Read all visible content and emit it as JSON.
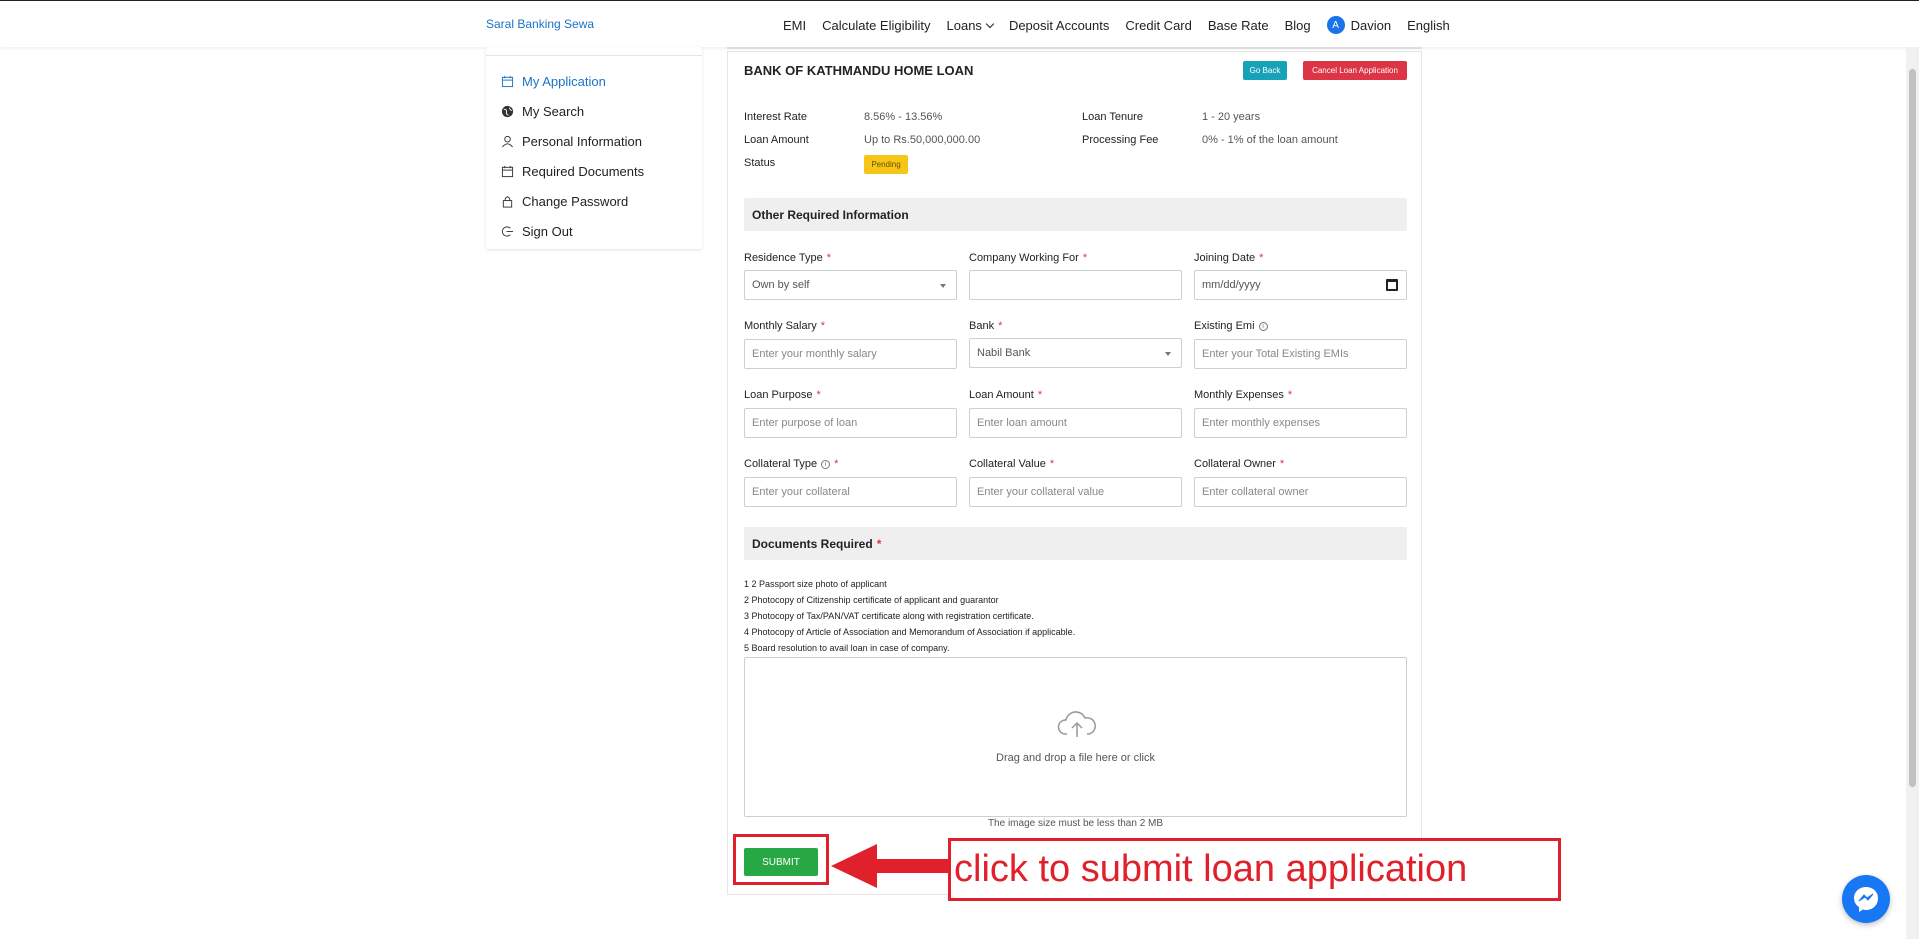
{
  "header": {
    "brand": "Saral Banking Sewa",
    "nav": [
      "EMI",
      "Calculate Eligibility",
      "Loans",
      "Deposit Accounts",
      "Credit Card",
      "Base Rate",
      "Blog"
    ],
    "user_initial": "A",
    "user_name": "Davion",
    "language": "English"
  },
  "sidebar": {
    "items": [
      {
        "label": "My Application",
        "icon": "calendar-icon",
        "active": true
      },
      {
        "label": "My Search",
        "icon": "globe-icon"
      },
      {
        "label": "Personal Information",
        "icon": "user-icon"
      },
      {
        "label": "Required Documents",
        "icon": "calendar-icon"
      },
      {
        "label": "Change Password",
        "icon": "lock-icon"
      },
      {
        "label": "Sign Out",
        "icon": "sign-out-icon"
      }
    ]
  },
  "loan": {
    "title": "BANK OF KATHMANDU HOME LOAN",
    "go_back": "Go Back",
    "cancel": "Cancel Loan Application",
    "interest_rate_label": "Interest Rate",
    "interest_rate": "8.56% - 13.56%",
    "loan_amount_label": "Loan Amount",
    "loan_amount": "Up to Rs.50,000,000.00",
    "status_label": "Status",
    "status": "Pending",
    "tenure_label": "Loan Tenure",
    "tenure": "1 - 20 years",
    "fee_label": "Processing Fee",
    "fee": "0% - 1% of the loan amount"
  },
  "form": {
    "section_title": "Other Required Information",
    "residence_type": {
      "label": "Residence Type",
      "value": "Own by self"
    },
    "company": {
      "label": "Company Working For",
      "value": ""
    },
    "joining_date": {
      "label": "Joining Date",
      "placeholder": "mm/dd/yyyy"
    },
    "monthly_salary": {
      "label": "Monthly Salary",
      "placeholder": "Enter your monthly salary"
    },
    "bank": {
      "label": "Bank",
      "value": "Nabil Bank"
    },
    "existing_emi": {
      "label": "Existing Emi",
      "placeholder": "Enter your Total Existing EMIs"
    },
    "loan_purpose": {
      "label": "Loan Purpose",
      "placeholder": "Enter purpose of loan"
    },
    "loan_amount": {
      "label": "Loan Amount",
      "placeholder": "Enter loan amount"
    },
    "monthly_expenses": {
      "label": "Monthly Expenses",
      "placeholder": "Enter monthly expenses"
    },
    "collateral_type": {
      "label": "Collateral Type",
      "placeholder": "Enter your collateral"
    },
    "collateral_value": {
      "label": "Collateral Value",
      "placeholder": "Enter your collateral value"
    },
    "collateral_owner": {
      "label": "Collateral Owner",
      "placeholder": "Enter collateral owner"
    }
  },
  "documents": {
    "title": "Documents Required",
    "list": [
      "1 2 Passport size photo of applicant",
      "2 Photocopy of Citizenship certificate of applicant and guarantor",
      "3 Photocopy of Tax/PAN/VAT certificate along with registration certificate.",
      "4 Photocopy of Article of Association and Memorandum of Association if applicable.",
      "5 Board resolution to avail loan in case of company."
    ],
    "dropzone_text": "Drag and drop a file here or click",
    "size_note": "The image size must be less than 2 MB"
  },
  "submit_label": "SUBMIT",
  "annotation": "click to submit loan application",
  "colors": {
    "brand": "#1a73c8",
    "submit": "#28a745",
    "cancel": "#dc3545",
    "go_back": "#17a2b8",
    "pending": "#f5c518",
    "annotation": "#e0202a"
  }
}
